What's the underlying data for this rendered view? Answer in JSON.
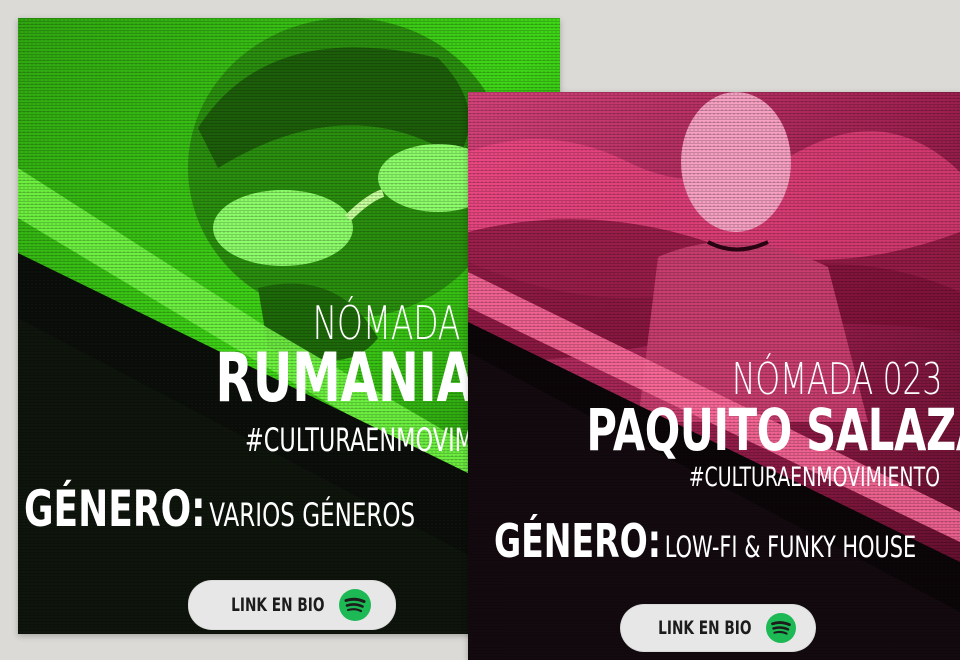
{
  "posts": [
    {
      "nomada": "NÓMADA",
      "artist": "RUMANIA",
      "hashtag": "#CULTURAENMOVIM",
      "genre_key": "GÉNERO:",
      "genre_value": "VARIOS GÉNEROS",
      "link_label": "LINK EN BIO",
      "icon": "spotify-icon",
      "accent": "#3dd413"
    },
    {
      "nomada": "NÓMADA 023",
      "artist": "PAQUITO SALAZAR",
      "hashtag": "#CULTURAENMOVIMIENTO",
      "genre_key": "GÉNERO:",
      "genre_value": "LOW-FI & FUNKY HOUSE",
      "link_label": "LINK EN BIO",
      "icon": "spotify-icon",
      "accent": "#e2396f"
    }
  ]
}
